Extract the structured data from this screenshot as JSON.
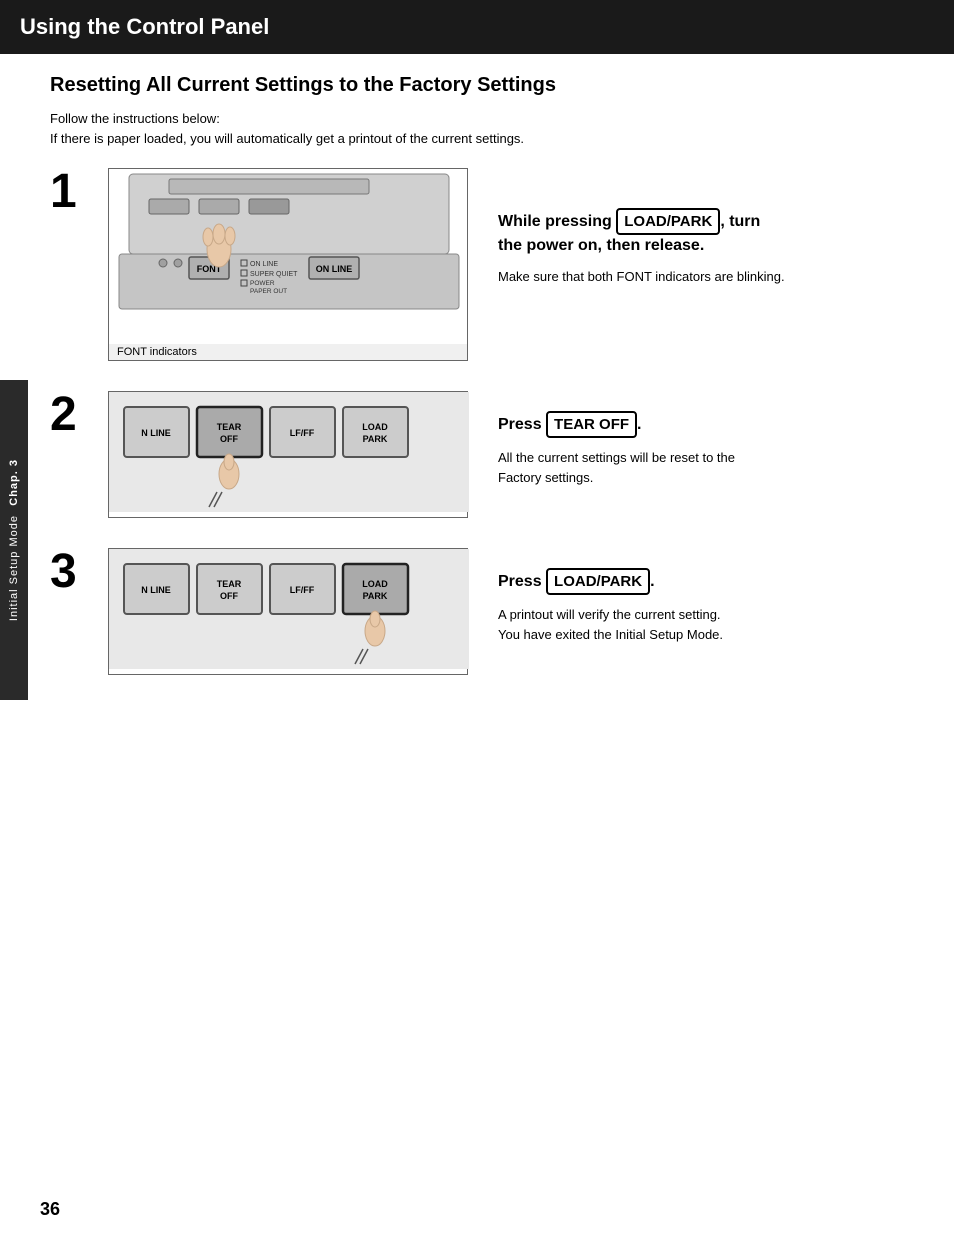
{
  "header": {
    "title": "Using the Control Panel",
    "background": "#1a1a1a"
  },
  "side_tab": {
    "chap_label": "Chap. 3",
    "mode_label": "Initial Setup Mode"
  },
  "page": {
    "title": "Resetting All Current Settings to the Factory Settings",
    "intro_line1": "Follow the instructions below:",
    "intro_line2": "If there is paper loaded, you will automatically get a printout of the current settings.",
    "page_number": "36"
  },
  "steps": [
    {
      "number": "1",
      "instruction_main": "While pressing  LOAD/PARK , turn the power on, then release.",
      "instruction_sub": "Make sure that both FONT indicators are blinking.",
      "kbd_label": "LOAD/PARK",
      "diagram_labels": {
        "font_indicators": "FONT indicators",
        "font_btn": "FONT",
        "on_line_btn": "ON LINE",
        "on_line_indicator": "ON LINE",
        "super_quiet": "SUPER QUIET",
        "power_paper_out": "POWER\nPAPER OUT"
      }
    },
    {
      "number": "2",
      "instruction_main": "Press  TEAR OFF .",
      "instruction_sub_line1": "All the current settings will be reset to the",
      "instruction_sub_line2": "Factory settings.",
      "kbd_label": "TEAR OFF",
      "keys": [
        "N LINE",
        "TEAR\nOFF",
        "LF/FF",
        "LOAD\nPARK"
      ],
      "pressed_key_index": 1
    },
    {
      "number": "3",
      "instruction_main": "Press  LOAD/PARK .",
      "instruction_sub_line1": "A printout will verify the current setting.",
      "instruction_sub_line2": "You have exited the Initial Setup Mode.",
      "kbd_label": "LOAD/PARK",
      "keys": [
        "N LINE",
        "TEAR\nOFF",
        "LF/FF",
        "LOAD\nPARK"
      ],
      "pressed_key_index": 3
    }
  ]
}
